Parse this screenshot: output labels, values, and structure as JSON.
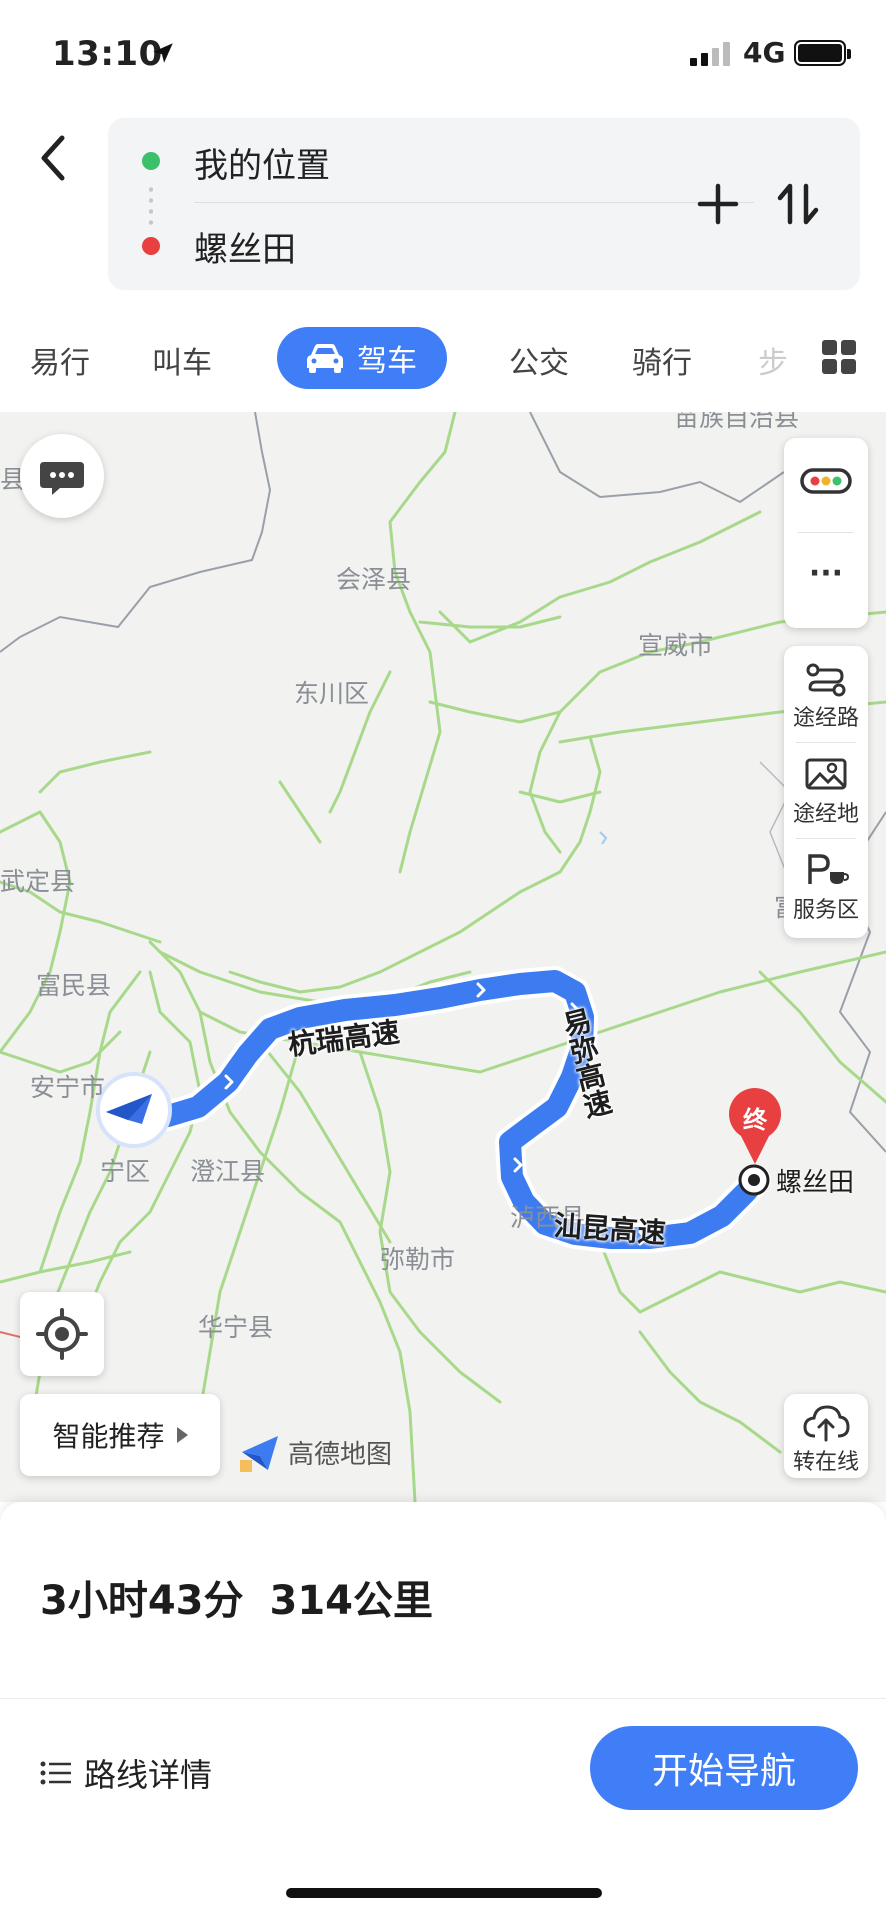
{
  "status_bar": {
    "time": "13:10",
    "network": "4G"
  },
  "route": {
    "start": "我的位置",
    "destination": "螺丝田"
  },
  "tabs": [
    "易行",
    "叫车",
    "驾车",
    "公交",
    "骑行",
    "步"
  ],
  "active_tab": "驾车",
  "map": {
    "places": [
      "县",
      "会泽县",
      "东川区",
      "宣威市",
      "武定县",
      "富民县",
      "安宁市",
      "宁区",
      "澄江县",
      "泸西县",
      "弥勒市",
      "华宁县",
      "苗族自治县",
      "富"
    ],
    "roads": [
      "杭瑞高速",
      "易弥高速",
      "汕昆高速"
    ],
    "end_marker": "终",
    "end_label": "螺丝田",
    "controls": {
      "via_road": "途经路",
      "via_place": "途经地",
      "service_area": "服务区",
      "switch_online": "转在线",
      "smart_recommend": "智能推荐",
      "more": "···"
    },
    "logo_text": "高德地图"
  },
  "summary": {
    "duration": "3小时43分",
    "distance": "314公里"
  },
  "actions": {
    "route_details": "路线详情",
    "start_navigation": "开始导航"
  },
  "colors": {
    "accent": "#3f7ef7",
    "route": "#3c7cf0",
    "highway": "#a8d98b",
    "start_dot": "#3cc06c",
    "end_dot": "#e84040"
  }
}
